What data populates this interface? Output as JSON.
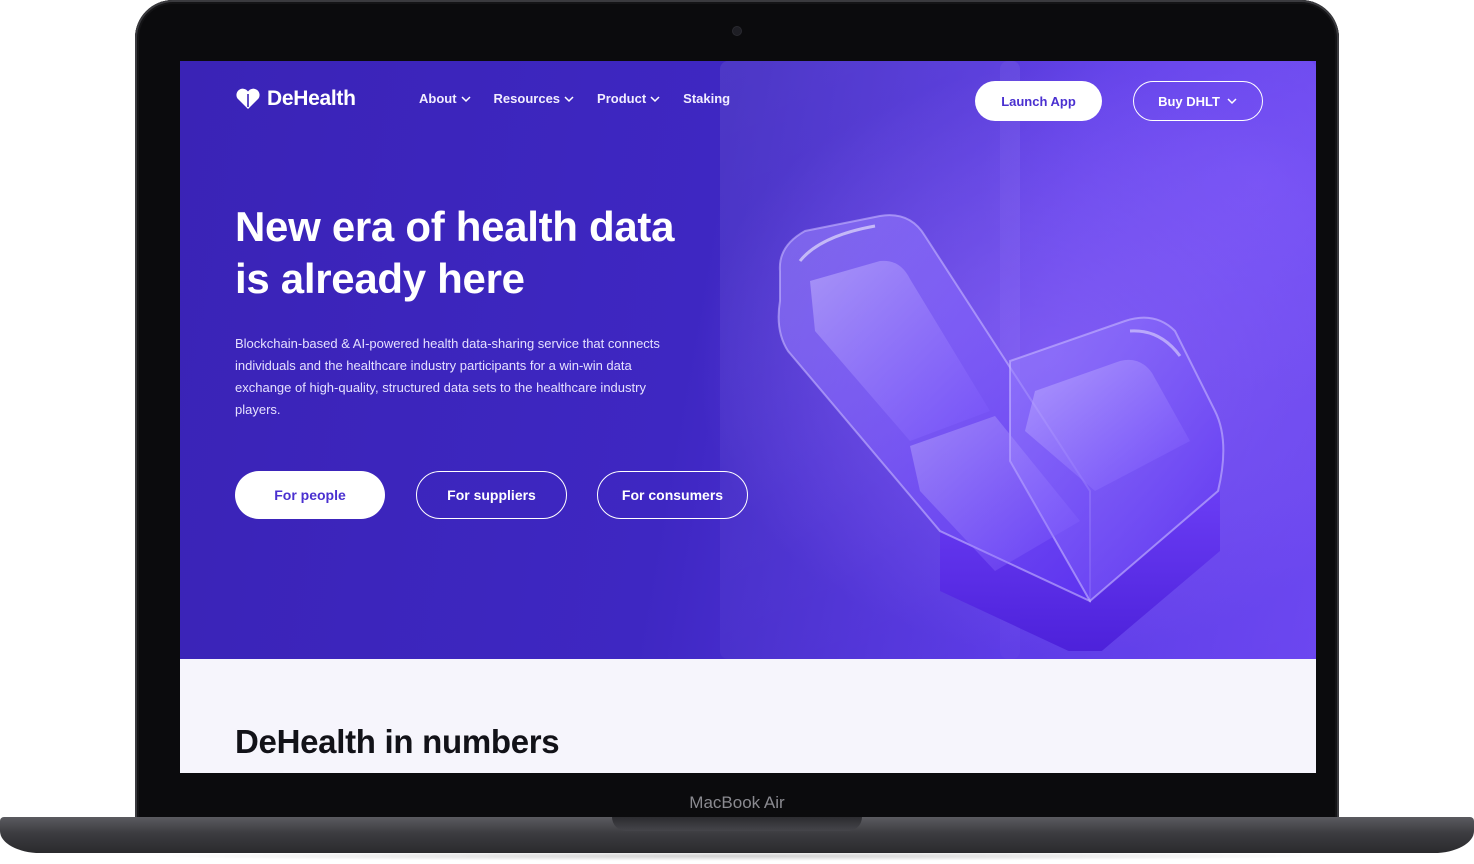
{
  "device": {
    "label": "MacBook Air"
  },
  "brand": {
    "name": "DeHealth",
    "logo_icon": "heart-icon"
  },
  "nav": {
    "items": [
      {
        "label": "About",
        "has_dropdown": true
      },
      {
        "label": "Resources",
        "has_dropdown": true
      },
      {
        "label": "Product",
        "has_dropdown": true
      },
      {
        "label": "Staking",
        "has_dropdown": false
      }
    ],
    "launch_label": "Launch App",
    "buy_label": "Buy DHLT"
  },
  "hero": {
    "headline_line1": "New era of health data",
    "headline_line2": "is already here",
    "description": "Blockchain-based & AI-powered health data-sharing service that connects individuals and the healthcare industry participants for a win-win data exchange of high-quality, structured data sets to the healthcare industry players.",
    "cta": {
      "people": "For people",
      "suppliers": "For suppliers",
      "consumers": "For consumers"
    }
  },
  "numbers_section": {
    "title": "DeHealth in numbers"
  },
  "colors": {
    "hero_start": "#3a23b6",
    "hero_end": "#6a45f0",
    "accent_text": "#4a30d0",
    "section_bg": "#f6f5fc"
  }
}
